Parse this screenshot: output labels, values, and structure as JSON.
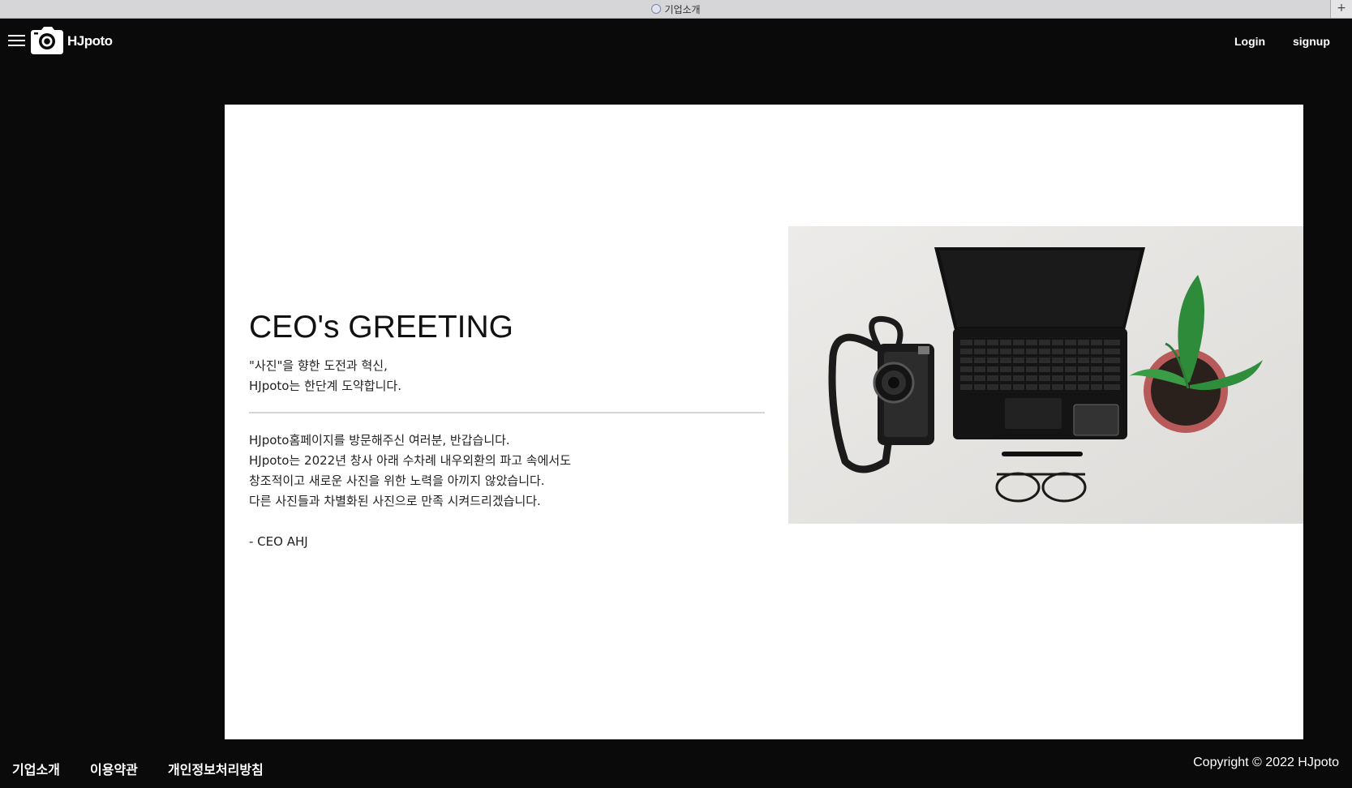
{
  "browser": {
    "tab_title": "기업소개",
    "new_tab": "+"
  },
  "header": {
    "brand": "HJpoto",
    "nav": {
      "login": "Login",
      "signup": "signup"
    }
  },
  "greeting": {
    "title": "CEO's GREETING",
    "subtitle_lines": [
      "\"사진\"을 향한 도전과 혁신,",
      "HJpoto는 한단계 도약합니다."
    ],
    "body_lines": [
      "HJpoto홈페이지를 방문해주신 여러분, 반갑습니다.",
      "HJpoto는 2022년 창사 아래 수차례 내우외환의 파고 속에서도",
      "창조적이고 새로운 사진을 위한 노력을 아끼지 않았습니다.",
      "다른 사진들과 차별화된 사진으로 만족 시켜드리겠습니다."
    ],
    "signature": "- CEO AHJ"
  },
  "footer": {
    "links": [
      "기업소개",
      "이용약관",
      "개인정보처리방침"
    ],
    "copyright": "Copyright © 2022 HJpoto"
  },
  "colors": {
    "page_bg": "#0a0a0a",
    "card_bg": "#ffffff",
    "text": "#222222",
    "divider": "#d5d5d5"
  },
  "icons": [
    "hamburger-menu-icon",
    "camera-logo-icon",
    "tab-favicon-icon"
  ]
}
